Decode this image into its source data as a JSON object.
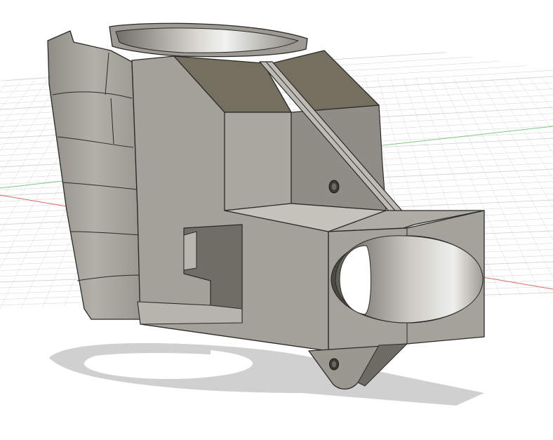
{
  "viewport": {
    "background": "#ffffff",
    "grid_color": "#cfd3d6",
    "x_axis_color": "#e06666",
    "y_axis_color": "#7fc97f",
    "part_color": "#a9a9a1",
    "part_dark_color": "#6e6c62",
    "edge_color": "#2a2a2a",
    "shadow_color": "#d0d0d0"
  },
  "model": {
    "features": [
      "cup-holder-ring",
      "angled-slot-face",
      "oval-bore",
      "mounting-hole",
      "screw-tab",
      "side-cutout"
    ]
  }
}
